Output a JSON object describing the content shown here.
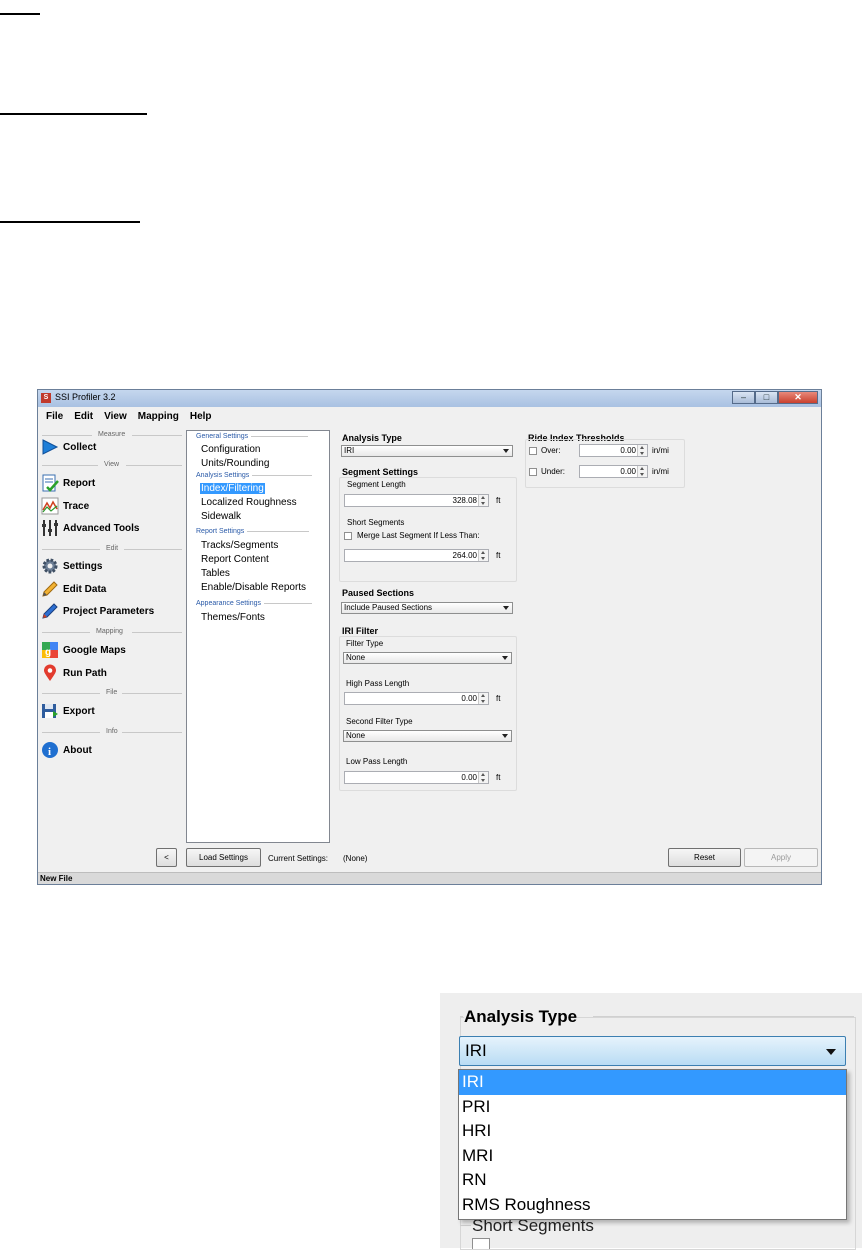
{
  "window": {
    "title": "SSI Profiler 3.2",
    "menu": [
      "File",
      "Edit",
      "View",
      "Mapping",
      "Help"
    ],
    "status": "New File"
  },
  "nav": {
    "sections": [
      "Measure",
      "View",
      "Edit",
      "Mapping",
      "File",
      "Info"
    ],
    "items": [
      {
        "label": "Collect",
        "icon": "play-arrow-icon"
      },
      {
        "label": "Report",
        "icon": "report-check-icon"
      },
      {
        "label": "Trace",
        "icon": "trace-graph-icon"
      },
      {
        "label": "Advanced Tools",
        "icon": "sliders-icon"
      },
      {
        "label": "Settings",
        "icon": "gear-icon"
      },
      {
        "label": "Edit Data",
        "icon": "pencil-icon"
      },
      {
        "label": "Project Parameters",
        "icon": "pencil-ruler-icon"
      },
      {
        "label": "Google Maps",
        "icon": "google-maps-icon"
      },
      {
        "label": "Run Path",
        "icon": "map-pin-icon"
      },
      {
        "label": "Export",
        "icon": "floppy-export-icon"
      },
      {
        "label": "About",
        "icon": "info-icon"
      }
    ],
    "collapse_button": "<"
  },
  "tree": {
    "groups": [
      {
        "heading": "General Settings",
        "items": [
          "Configuration",
          "Units/Rounding"
        ]
      },
      {
        "heading": "Analysis Settings",
        "items": [
          "Index/Filtering",
          "Localized Roughness",
          "Sidewalk"
        ]
      },
      {
        "heading": "Report Settings",
        "items": [
          "Tracks/Segments",
          "Report Content",
          "Tables",
          "Enable/Disable Reports"
        ]
      },
      {
        "heading": "Appearance Settings",
        "items": [
          "Themes/Fonts"
        ]
      }
    ],
    "selected": "Index/Filtering"
  },
  "settings": {
    "analysis_type": {
      "label": "Analysis Type",
      "value": "IRI"
    },
    "segment_settings": {
      "label": "Segment Settings",
      "segment_length_label": "Segment Length",
      "segment_length_value": "328.08",
      "segment_length_unit": "ft",
      "short_segments_label": "Short Segments",
      "merge_label": "Merge Last Segment If Less Than:",
      "merge_value": "264.00",
      "merge_unit": "ft"
    },
    "paused_sections": {
      "label": "Paused Sections",
      "value": "Include Paused Sections"
    },
    "iri_filter": {
      "label": "IRI Filter",
      "filter_type_label": "Filter Type",
      "filter_type_value": "None",
      "high_pass_label": "High Pass Length",
      "high_pass_value": "0.00",
      "high_pass_unit": "ft",
      "second_filter_label": "Second Filter Type",
      "second_filter_value": "None",
      "low_pass_label": "Low Pass Length",
      "low_pass_value": "0.00",
      "low_pass_unit": "ft"
    },
    "ride_index": {
      "label": "Ride Index Thresholds",
      "over_label": "Over:",
      "over_value": "0.00",
      "under_label": "Under:",
      "under_value": "0.00",
      "unit": "in/mi"
    }
  },
  "bottom": {
    "load_settings": "Load Settings",
    "current_settings_label": "Current Settings:",
    "current_settings_value": "(None)",
    "reset": "Reset",
    "apply": "Apply"
  },
  "zoom": {
    "title": "Analysis Type",
    "selected": "IRI",
    "options": [
      "IRI",
      "PRI",
      "HRI",
      "MRI",
      "RN",
      "RMS Roughness"
    ],
    "partial_label": "Short Segments"
  }
}
